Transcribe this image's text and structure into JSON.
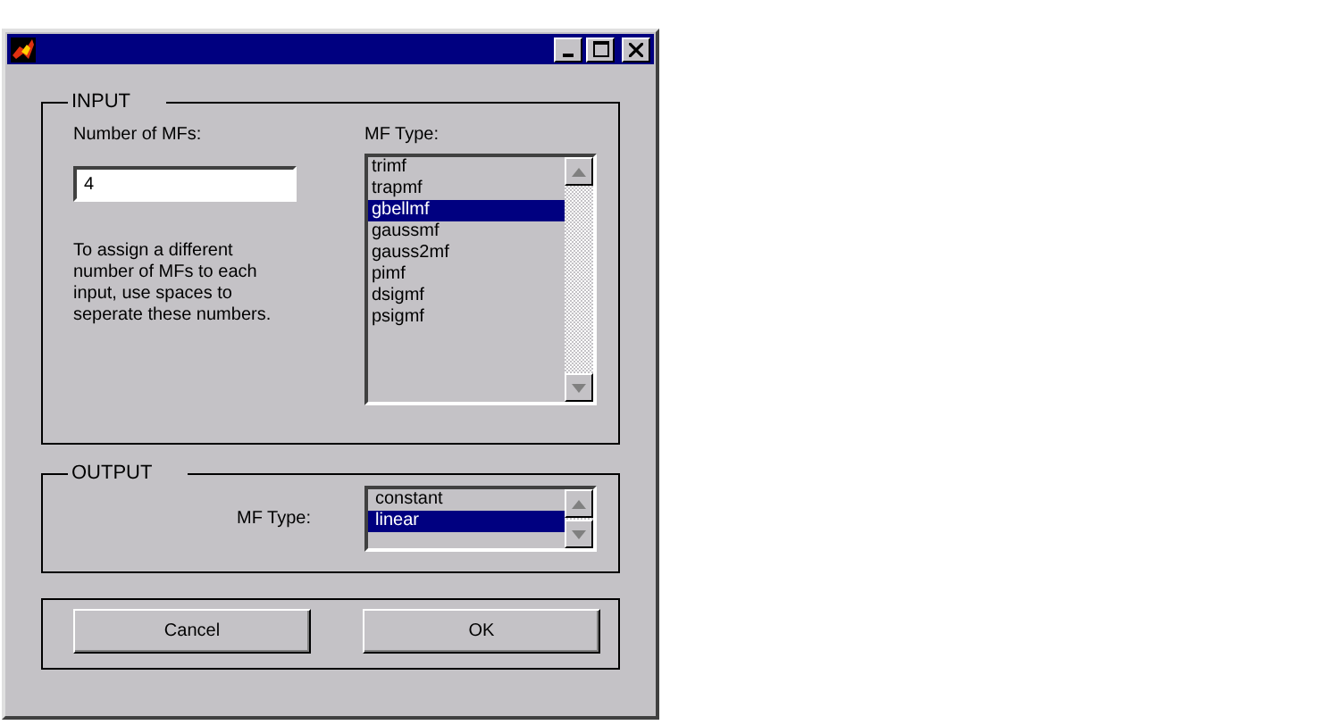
{
  "input": {
    "legend": "INPUT",
    "count_label": "Number of MFs:",
    "count_value": "4",
    "help": "To assign a different number of MFs to each input, use spaces to seperate these numbers.",
    "type_label": "MF Type:",
    "types": [
      {
        "label": "trimf",
        "selected": false
      },
      {
        "label": "trapmf",
        "selected": false
      },
      {
        "label": "gbellmf",
        "selected": true
      },
      {
        "label": "gaussmf",
        "selected": false
      },
      {
        "label": "gauss2mf",
        "selected": false
      },
      {
        "label": "pimf",
        "selected": false
      },
      {
        "label": "dsigmf",
        "selected": false
      },
      {
        "label": "psigmf",
        "selected": false
      }
    ]
  },
  "output": {
    "legend": "OUTPUT",
    "type_label": "MF Type:",
    "types": [
      {
        "label": "constant",
        "selected": false
      },
      {
        "label": "linear",
        "selected": true
      }
    ]
  },
  "buttons": [
    "Cancel",
    "OK"
  ]
}
